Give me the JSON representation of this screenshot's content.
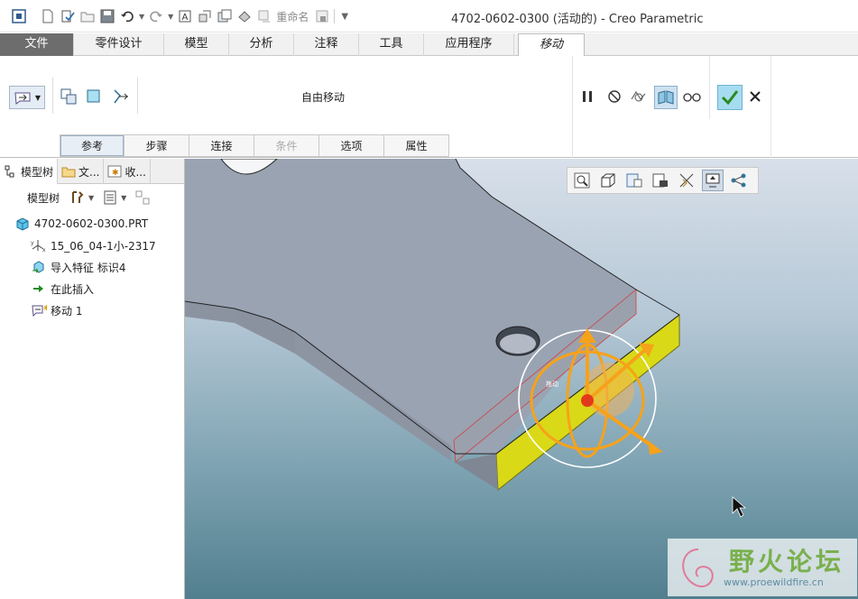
{
  "window": {
    "title": "4702-0602-0300 (活动的) - Creo Parametric"
  },
  "quick_access": {
    "rename_label": "重命名",
    "icons": [
      "app-icon",
      "new-icon",
      "save-regenerate-icon",
      "open-icon",
      "save-icon",
      "undo-icon",
      "redo-icon",
      "text-icon",
      "copy-icon",
      "window-icon",
      "regenerate-icon",
      "rename-icon",
      "erase-icon",
      "customize-icon"
    ]
  },
  "ribbon": {
    "tabs": [
      "文件",
      "零件设计",
      "模型",
      "分析",
      "注释",
      "工具",
      "应用程序",
      "移动"
    ],
    "active_tab": "移动",
    "move_type_label": "自由移动",
    "subtabs": [
      "参考",
      "步骤",
      "连接",
      "条件",
      "选项",
      "属性"
    ],
    "disabled_subtab": "条件",
    "actions": [
      "pause-icon",
      "no-icon",
      "preview-icon",
      "verify-icon",
      "glasses-icon",
      "confirm-icon",
      "cancel-icon"
    ]
  },
  "left_panel": {
    "tabs": [
      "模型树",
      "文...",
      "收..."
    ],
    "toolbar_label": "模型树",
    "tree": [
      {
        "label": "4702-0602-0300.PRT",
        "icon": "part-icon"
      },
      {
        "label": "15_06_04-1小-2317",
        "icon": "csys-icon"
      },
      {
        "label": "导入特征 标识4",
        "icon": "import-feature-icon"
      },
      {
        "label": "在此插入",
        "icon": "insert-here-arrow-icon"
      },
      {
        "label": "移动 1",
        "icon": "move-feature-icon"
      }
    ]
  },
  "viewport": {
    "toolbar": [
      "zoom-icon",
      "refit-icon",
      "named-view-icon",
      "display-style-icon",
      "datum-display-icon",
      "spin-center-icon",
      "model-tree-toggle-icon"
    ],
    "dragger_label": "拖动",
    "colors": {
      "part_face": "#9da5b3",
      "highlight_face": "#e5e51f",
      "dragger": "#f6a21a"
    }
  },
  "watermark": {
    "text": "野火论坛",
    "url": "www.proewildfire.cn"
  }
}
